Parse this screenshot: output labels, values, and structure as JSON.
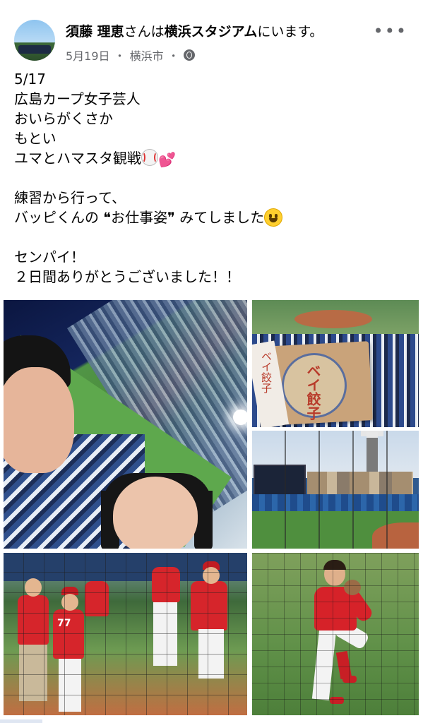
{
  "post": {
    "author": "須藤 理恵",
    "connector": "さんは",
    "location": "横浜スタジアム",
    "location_suffix": "にいます。",
    "date": "5月19日",
    "separator": "・",
    "city": "横浜市",
    "separator2": "・",
    "more_label": "•••",
    "privacy_icon": "globe-icon"
  },
  "text": {
    "line1": "5/17",
    "line2": "広島カープ女子芸人",
    "line3": "おいらがくさか",
    "line4": "もとい",
    "line5": "ユマとハマスタ観戦",
    "line6": "練習から行って、",
    "line7_a": "バッピくんの ",
    "line7_quote_open": "❝",
    "line7_b": "お仕事姿",
    "line7_quote_close": "❞",
    "line7_c": " みてしました",
    "line8": "センパイ！",
    "line9": "２日間ありがとうございました！！",
    "hearts": "💕"
  },
  "photos": {
    "p2_box_text": "ベイ餃子",
    "p2_tag_text": "ベイ餃子",
    "p4_number": "77"
  },
  "colors": {
    "carp_red": "#d6252b",
    "bay_blue": "#1f4c8c",
    "meta_gray": "#65676b"
  }
}
